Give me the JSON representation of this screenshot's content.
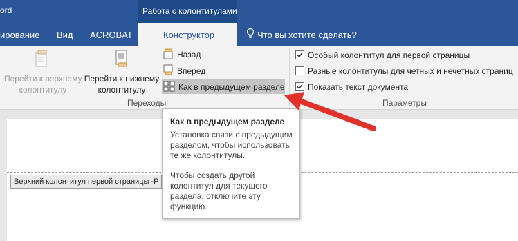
{
  "window": {
    "title_fragment": "ord"
  },
  "context_tab_group": {
    "label": "Работа с колонтитулами"
  },
  "tabs": [
    {
      "label": "ирование"
    },
    {
      "label": "Вид"
    },
    {
      "label": "ACROBAT"
    },
    {
      "label": "Конструктор",
      "active": true
    }
  ],
  "tell_me": {
    "placeholder": "Что вы хотите сделать?",
    "icon": "lightbulb-icon"
  },
  "navigation_group": {
    "label": "Переходы",
    "goto_header": {
      "label_line1": "Перейти к верхнему",
      "label_line2": "колонтитулу",
      "enabled": false
    },
    "goto_footer": {
      "label_line1": "Перейти к нижнему",
      "label_line2": "колонтитулу",
      "enabled": true
    },
    "previous": {
      "label": "Назад"
    },
    "next": {
      "label": "Вперед"
    },
    "link_to_previous": {
      "label": "Как в предыдущем разделе",
      "highlighted": true
    }
  },
  "options_group": {
    "label": "Параметры",
    "options": [
      {
        "label": "Особый колонтитул для первой страницы",
        "checked": true
      },
      {
        "label": "Разные колонтитулы для четных и нечетных страниц",
        "checked": false
      },
      {
        "label": "Показать текст документа",
        "checked": true
      }
    ]
  },
  "document": {
    "header_tag": "Верхний колонтитул первой страницы -Р"
  },
  "tooltip": {
    "title": "Как в предыдущем разделе",
    "paragraph1": "Установка связи с предыдущим\nразделом, чтобы использовать\nте же колонтитулы.",
    "paragraph2": "Чтобы создать другой\nколонтитул для текущего\nраздела, отключите эту\nфункцию."
  },
  "annotation": {
    "arrow_color": "#e0312b"
  },
  "colors": {
    "accent": "#2b579a",
    "ribbon": "#f3f3f3"
  }
}
